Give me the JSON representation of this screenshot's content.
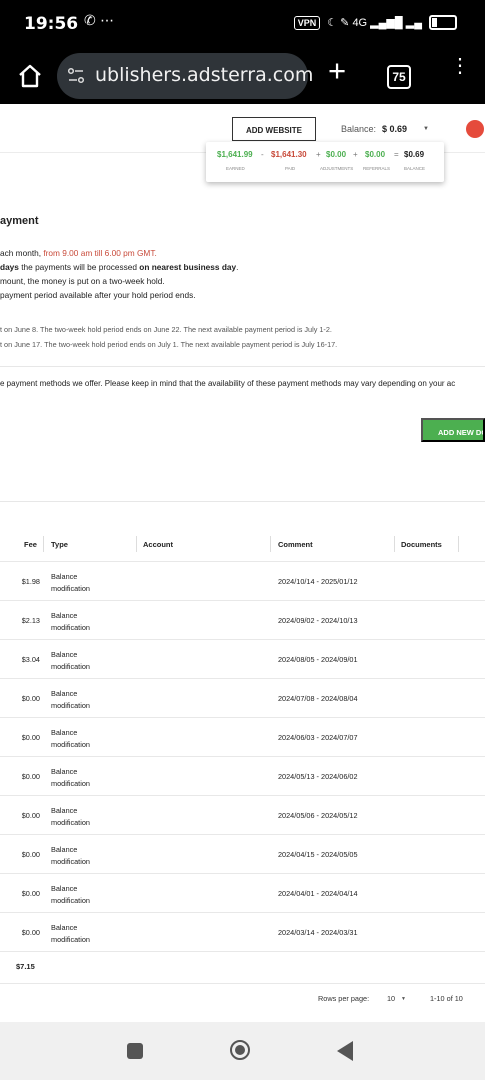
{
  "status": {
    "time": "19:56",
    "left_icons": "✆ ⋯",
    "vpn": "VPN",
    "right_icons": "☾ ✎ 4G ▂▄▆█ ▂▄"
  },
  "browser": {
    "url": "ublishers.adsterra.com",
    "plus": "+",
    "tab_count": "75",
    "menu": "⋮"
  },
  "header": {
    "add_website": "ADD WEBSITE",
    "balance_label": "Balance:",
    "balance_value": "$ 0.69",
    "caret": "▼"
  },
  "popup": {
    "values": [
      "$1,641.99",
      "-",
      "$1,641.30",
      "+",
      "$0.00",
      "+",
      "$0.00",
      "=",
      "$0.69"
    ],
    "labels": [
      "EARNED",
      "PAID",
      "ADJUSTMENTS",
      "REFERRALS",
      "BALANCE"
    ]
  },
  "payment": {
    "title": "ayment",
    "line1_a": "ach month, ",
    "line1_b": "from 9.00 am till 6.00 pm GMT.",
    "line2_a": "days",
    "line2_b": " the payments will be processed ",
    "line2_c": "on nearest business day",
    "line2_d": ".",
    "line3": "mount, the money is put on a two-week hold.",
    "line4": "payment period available after your hold period ends.",
    "note1": "t on June 8. The two-week hold period ends on June 22. The next available payment period is July 1-2.",
    "note2": "t on June 17. The two-week hold period ends on July 1. The next available payment period is July 16-17.",
    "methods": "e payment methods we offer. Please keep in mind that the availability of these payment methods may vary depending on your ac",
    "add_document": "ADD NEW DO"
  },
  "table": {
    "headers": [
      "Fee",
      "Type",
      "Account",
      "Comment",
      "Documents"
    ],
    "rows": [
      {
        "fee": "$1.98",
        "type": "Balance modification",
        "comment": "2024/10/14 - 2025/01/12"
      },
      {
        "fee": "$2.13",
        "type": "Balance modification",
        "comment": "2024/09/02 - 2024/10/13"
      },
      {
        "fee": "$3.04",
        "type": "Balance modification",
        "comment": "2024/08/05 - 2024/09/01"
      },
      {
        "fee": "$0.00",
        "type": "Balance modification",
        "comment": "2024/07/08 - 2024/08/04"
      },
      {
        "fee": "$0.00",
        "type": "Balance modification",
        "comment": "2024/06/03 - 2024/07/07"
      },
      {
        "fee": "$0.00",
        "type": "Balance modification",
        "comment": "2024/05/13 - 2024/06/02"
      },
      {
        "fee": "$0.00",
        "type": "Balance modification",
        "comment": "2024/05/06 - 2024/05/12"
      },
      {
        "fee": "$0.00",
        "type": "Balance modification",
        "comment": "2024/04/15 - 2024/05/05"
      },
      {
        "fee": "$0.00",
        "type": "Balance modification",
        "comment": "2024/04/01 - 2024/04/14"
      },
      {
        "fee": "$0.00",
        "type": "Balance modification",
        "comment": "2024/03/14 - 2024/03/31"
      }
    ],
    "total": "$7.15",
    "rows_per_page_label": "Rows per page:",
    "rows_per_page_value": "10",
    "range": "1-10 of 10"
  },
  "colors": {
    "accent_green": "#4caf50",
    "accent_red": "#c84a3a"
  },
  "icons": [
    "home-icon",
    "site-settings-icon",
    "plus-icon",
    "tabs-icon",
    "more-menu-icon",
    "profile-icon",
    "square-nav-icon",
    "home-nav-icon",
    "back-nav-icon"
  ]
}
